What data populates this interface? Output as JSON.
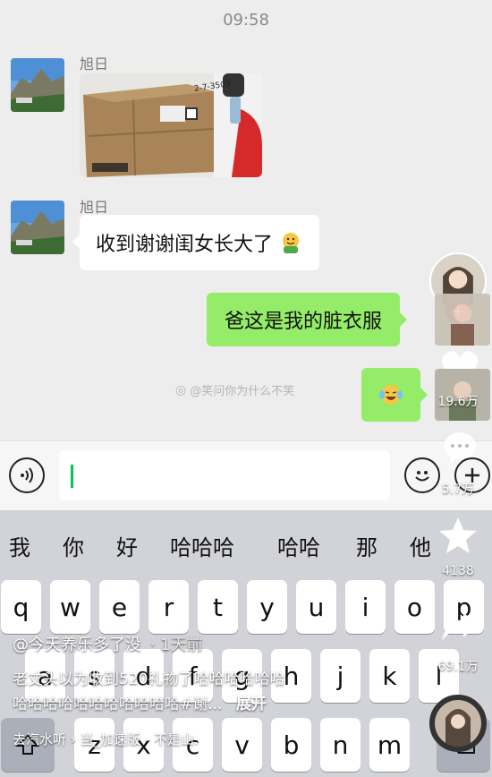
{
  "status_bar": {
    "time": "09:58"
  },
  "chat": {
    "messages": [
      {
        "sender": "旭日",
        "type": "image"
      },
      {
        "sender": "旭日",
        "type": "text",
        "text": "收到谢谢闺女长大了"
      },
      {
        "side": "right",
        "type": "text",
        "text": "爸这是我的脏衣服"
      },
      {
        "side": "right",
        "type": "emoji",
        "emoji": "laughing-tears-emoji"
      }
    ],
    "photo_label": "2-7-3509"
  },
  "watermark": {
    "text": "@笑问你为什么不笑"
  },
  "input_bar": {
    "voice_icon": "voice-icon",
    "emoji_icon": "smile-icon",
    "plus_icon": "plus-icon"
  },
  "keyboard": {
    "suggestions": [
      "我",
      "你",
      "好",
      "哈哈哈",
      "哈哈",
      "那",
      "他"
    ],
    "row1": [
      "q",
      "w",
      "e",
      "r",
      "t",
      "y",
      "u",
      "i",
      "o",
      "p"
    ],
    "row2": [
      "a",
      "s",
      "d",
      "f",
      "g",
      "h",
      "j",
      "k",
      "l"
    ],
    "row3": [
      "z",
      "x",
      "c",
      "v",
      "b",
      "n",
      "m"
    ]
  },
  "video_overlay": {
    "author": "@今天养乐多了没",
    "time_ago": "· 1天前",
    "caption_line1": "老丈头以为收到520礼物了哈哈哈哈哈哈",
    "caption_line2": "哈哈哈哈哈哈哈哈哈哈哈#谢...",
    "expand": "展开",
    "music": "去汽水听 › 当_加速版 - 不是山.",
    "likes": "19.6万",
    "comments": "5.7万",
    "favorites": "4138",
    "shares": "69.1万"
  },
  "colors": {
    "accent_green": "#95ec69",
    "wechat_green": "#07c160",
    "follow_red": "#fe2c55"
  }
}
